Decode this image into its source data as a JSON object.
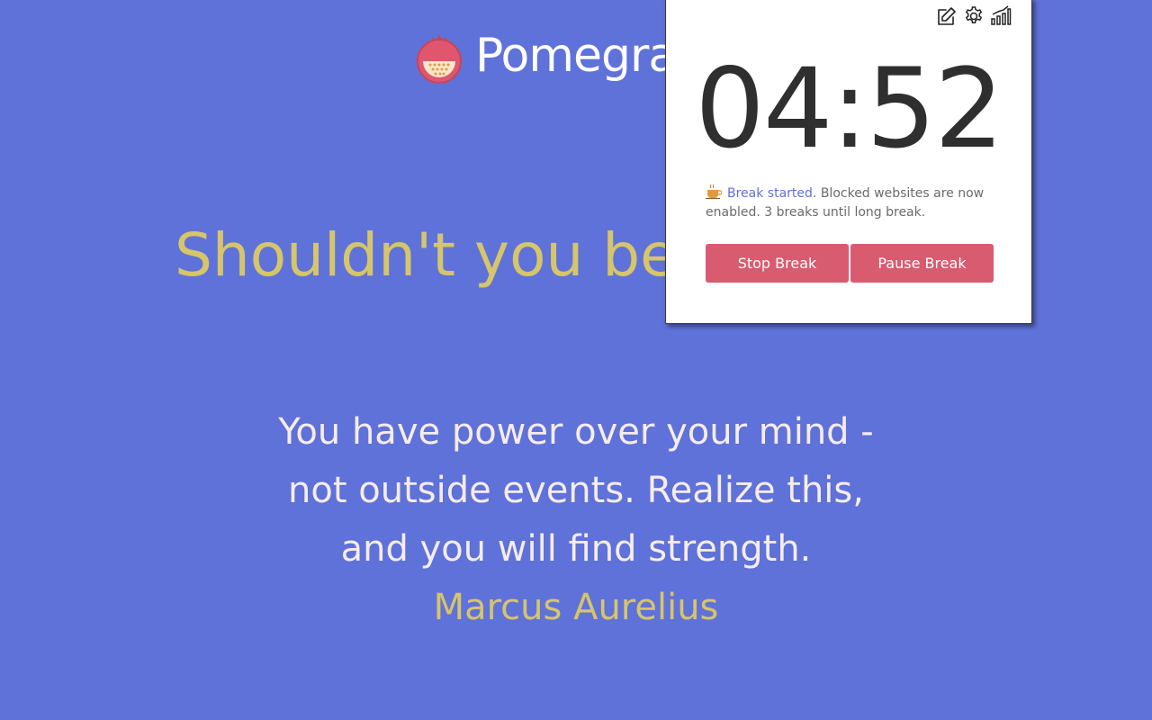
{
  "brand": {
    "name": "Pomegranate",
    "logo_icon": "pomegranate-icon",
    "logo_color": "#e0566e"
  },
  "main": {
    "headline": "Shouldn't you be focusing?",
    "quote": "You have power over your mind - not outside events. Realize this, and you will find strength.",
    "author": "Marcus Aurelius"
  },
  "popup": {
    "icons": [
      "edit-icon",
      "settings-gear-icon",
      "stats-chart-icon"
    ],
    "timer": "04:52",
    "status_icon": "coffee-cup-icon",
    "status_highlight": "Break started",
    "status_text": ". Blocked websites are now enabled. 3 breaks until long break.",
    "stop_label": "Stop Break",
    "pause_label": "Pause Break"
  },
  "colors": {
    "background": "#5f72d9",
    "accent_text": "#d6c56a",
    "quote_text": "#f6ece8",
    "button": "#d95b6f",
    "link": "#5f72d9"
  }
}
